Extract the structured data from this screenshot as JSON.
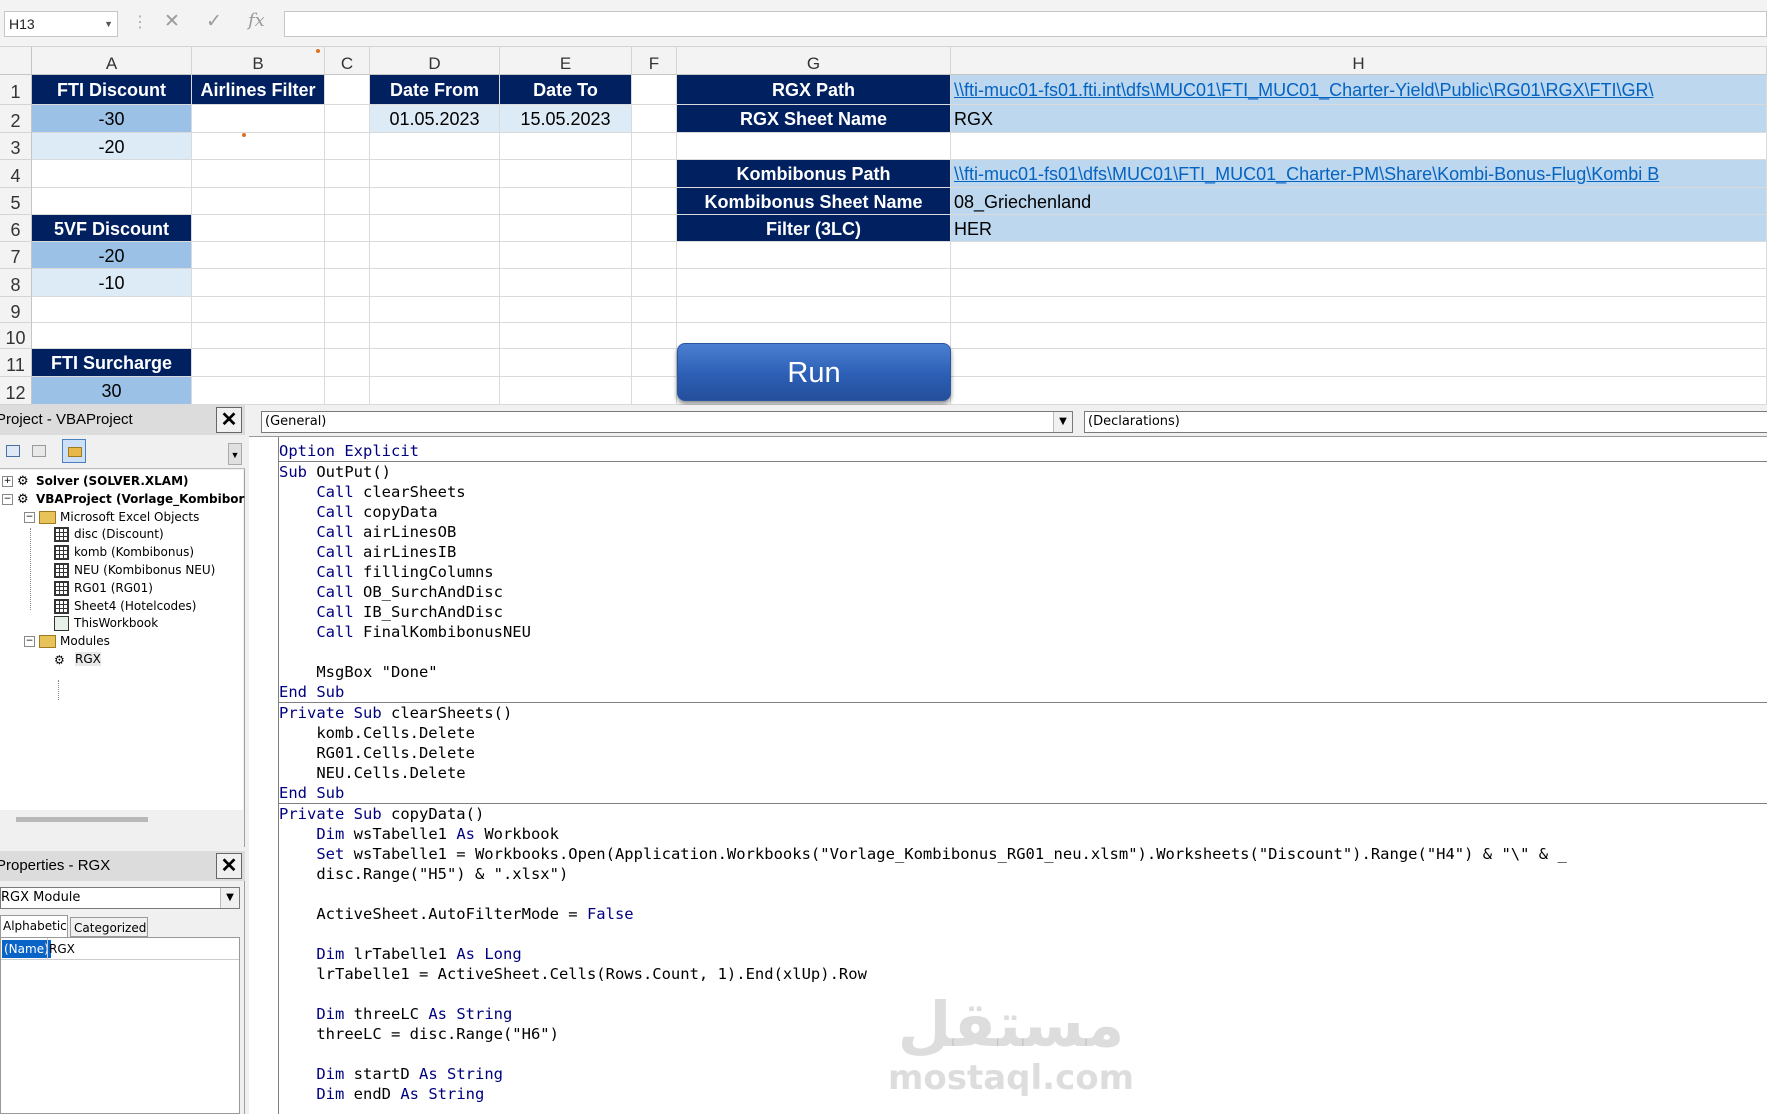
{
  "formula_bar": {
    "name_box": "H13",
    "fx_label": "fx",
    "cancel_icon": "close-icon",
    "enter_icon": "check-icon"
  },
  "columns": [
    "A",
    "B",
    "C",
    "D",
    "E",
    "F",
    "G",
    "H"
  ],
  "rows": [
    "1",
    "2",
    "3",
    "4",
    "5",
    "6",
    "7",
    "8",
    "9",
    "10",
    "11",
    "12"
  ],
  "cells": {
    "A1": "FTI Discount",
    "A2": "-30",
    "A3": "-20",
    "A6": "5VF Discount",
    "A7": "-20",
    "A8": "-10",
    "A11": "FTI Surcharge",
    "A12": "30",
    "B1": "Airlines Filter",
    "D1": "Date From",
    "D2": "01.05.2023",
    "E1": "Date To",
    "E2": "15.05.2023",
    "G1": "RGX Path",
    "G2": "RGX Sheet Name",
    "G4": "Kombibonus Path",
    "G5": "Kombibonus Sheet Name",
    "G6": "Filter (3LC)",
    "H1": "\\\\fti-muc01-fs01.fti.int\\dfs\\MUC01\\FTI_MUC01_Charter-Yield\\Public\\RG01\\RGX\\FTI\\GR\\",
    "H2": "RGX",
    "H4": "\\\\fti-muc01-fs01\\dfs\\MUC01\\FTI_MUC01_Charter-PM\\Share\\Kombi-Bonus-Flug\\Kombi B",
    "H5": "08_Griechenland",
    "H6": "HER"
  },
  "run_button": "Run",
  "project_pane": {
    "title": "Project - VBAProject",
    "tree": [
      {
        "label": "Solver (SOLVER.XLAM)",
        "bold": true,
        "icon": "vbproject-icon"
      },
      {
        "label": "VBAProject (Vorlage_Kombibor",
        "bold": true,
        "icon": "vbproject-icon"
      },
      {
        "label": "Microsoft Excel Objects",
        "icon": "folder-icon"
      },
      {
        "label": "disc (Discount)",
        "icon": "sheet-icon"
      },
      {
        "label": "komb (Kombibonus)",
        "icon": "sheet-icon"
      },
      {
        "label": "NEU (Kombibonus NEU)",
        "icon": "sheet-icon"
      },
      {
        "label": "RG01 (RG01)",
        "icon": "sheet-icon"
      },
      {
        "label": "Sheet4 (Hotelcodes)",
        "icon": "sheet-icon"
      },
      {
        "label": "ThisWorkbook",
        "icon": "workbook-icon"
      },
      {
        "label": "Modules",
        "icon": "folder-icon"
      },
      {
        "label": "RGX",
        "icon": "module-icon"
      }
    ]
  },
  "properties_pane": {
    "title": "Properties - RGX",
    "object_combo": "RGX Module",
    "tabs": [
      "Alphabetic",
      "Categorized"
    ],
    "prop_name": "(Name)",
    "prop_value": "RGX"
  },
  "code_window": {
    "object_combo": "(General)",
    "proc_combo": "(Declarations)",
    "lines": [
      "Option Explicit",
      "Sub OutPut()",
      "    Call clearSheets",
      "    Call copyData",
      "    Call airLinesOB",
      "    Call airLinesIB",
      "    Call fillingColumns",
      "    Call OB_SurchAndDisc",
      "    Call IB_SurchAndDisc",
      "    Call FinalKombibonusNEU",
      "",
      "    MsgBox \"Done\"",
      "End Sub",
      "Private Sub clearSheets()",
      "    komb.Cells.Delete",
      "    RG01.Cells.Delete",
      "    NEU.Cells.Delete",
      "End Sub",
      "Private Sub copyData()",
      "    Dim wsTabelle1 As Workbook",
      "    Set wsTabelle1 = Workbooks.Open(Application.Workbooks(\"Vorlage_Kombibonus_RG01_neu.xlsm\").Worksheets(\"Discount\").Range(\"H4\") & \"\\\" & _",
      "    disc.Range(\"H5\") & \".xlsx\")",
      "",
      "    ActiveSheet.AutoFilterMode = False",
      "",
      "    Dim lrTabelle1 As Long",
      "    lrTabelle1 = ActiveSheet.Cells(Rows.Count, 1).End(xlUp).Row",
      "",
      "    Dim threeLC As String",
      "    threeLC = disc.Range(\"H6\")",
      "",
      "    Dim startD As String",
      "    Dim endD As String"
    ],
    "separators_after": [
      0,
      12,
      17
    ]
  },
  "watermark": {
    "arabic": "مستقل",
    "latin": "mostaql.com"
  }
}
